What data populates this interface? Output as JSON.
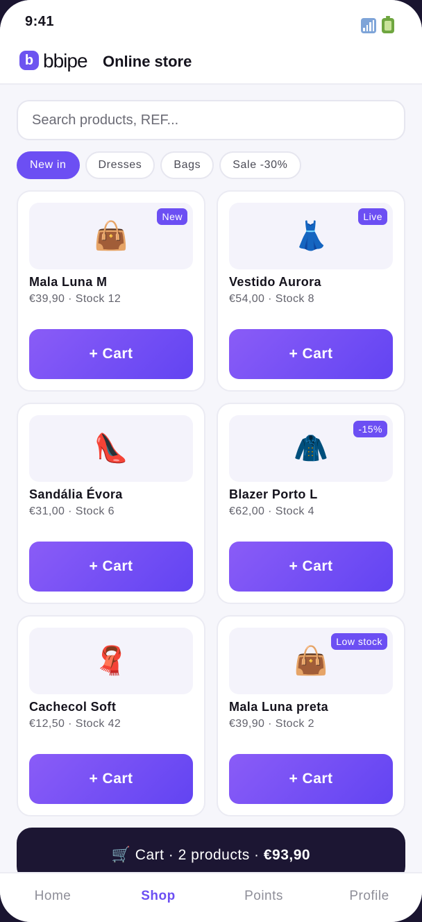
{
  "status_bar": {
    "time": "9:41",
    "icons": [
      "signal-icon",
      "battery-icon"
    ]
  },
  "header": {
    "logo_mark": "b",
    "logo_word": "bbipe",
    "title": "Online store"
  },
  "search": {
    "placeholder": "Search products, REF..."
  },
  "filters": [
    {
      "label": "New in",
      "active": true
    },
    {
      "label": "Dresses",
      "active": false
    },
    {
      "label": "Bags",
      "active": false
    },
    {
      "label": "Sale -30%",
      "active": false
    }
  ],
  "products": [
    {
      "name": "Mala Luna M",
      "price": "€39,90",
      "stock": "Stock 12",
      "meta": "€39,90 · Stock 12",
      "icon": "👜",
      "badge": "New",
      "button": "+ Cart"
    },
    {
      "name": "Vestido Aurora",
      "price": "€54,00",
      "stock": "Stock 8",
      "meta": "€54,00 · Stock 8",
      "icon": "👗",
      "badge": "Live",
      "button": "+ Cart"
    },
    {
      "name": "Sandália Évora",
      "price": "€31,00",
      "stock": "Stock 6",
      "meta": "€31,00 · Stock 6",
      "icon": "👠",
      "badge": "",
      "button": "+ Cart"
    },
    {
      "name": "Blazer Porto L",
      "price": "€62,00",
      "stock": "Stock 4",
      "meta": "€62,00 · Stock 4",
      "icon": "🧥",
      "badge": "-15%",
      "button": "+ Cart"
    },
    {
      "name": "Cachecol Soft",
      "price": "€12,50",
      "stock": "Stock 42",
      "meta": "€12,50 · Stock 42",
      "icon": "🧣",
      "badge": "",
      "button": "+ Cart"
    },
    {
      "name": "Mala Luna preta",
      "price": "€39,90",
      "stock": "Stock 2",
      "meta": "€39,90 · Stock 2",
      "icon": "👜",
      "badge": "Low stock",
      "button": "+ Cart"
    }
  ],
  "cart_bar": {
    "icon": "🛒",
    "label": "Cart · 2 products · ",
    "total": "€93,90"
  },
  "tabs": [
    {
      "label": "Home",
      "active": false
    },
    {
      "label": "Shop",
      "active": true
    },
    {
      "label": "Points",
      "active": false
    },
    {
      "label": "Profile",
      "active": false
    }
  ],
  "colors": {
    "accent": "#6c4ff3",
    "cart_bar": "#1c1633",
    "background": "#f6f6fb"
  }
}
